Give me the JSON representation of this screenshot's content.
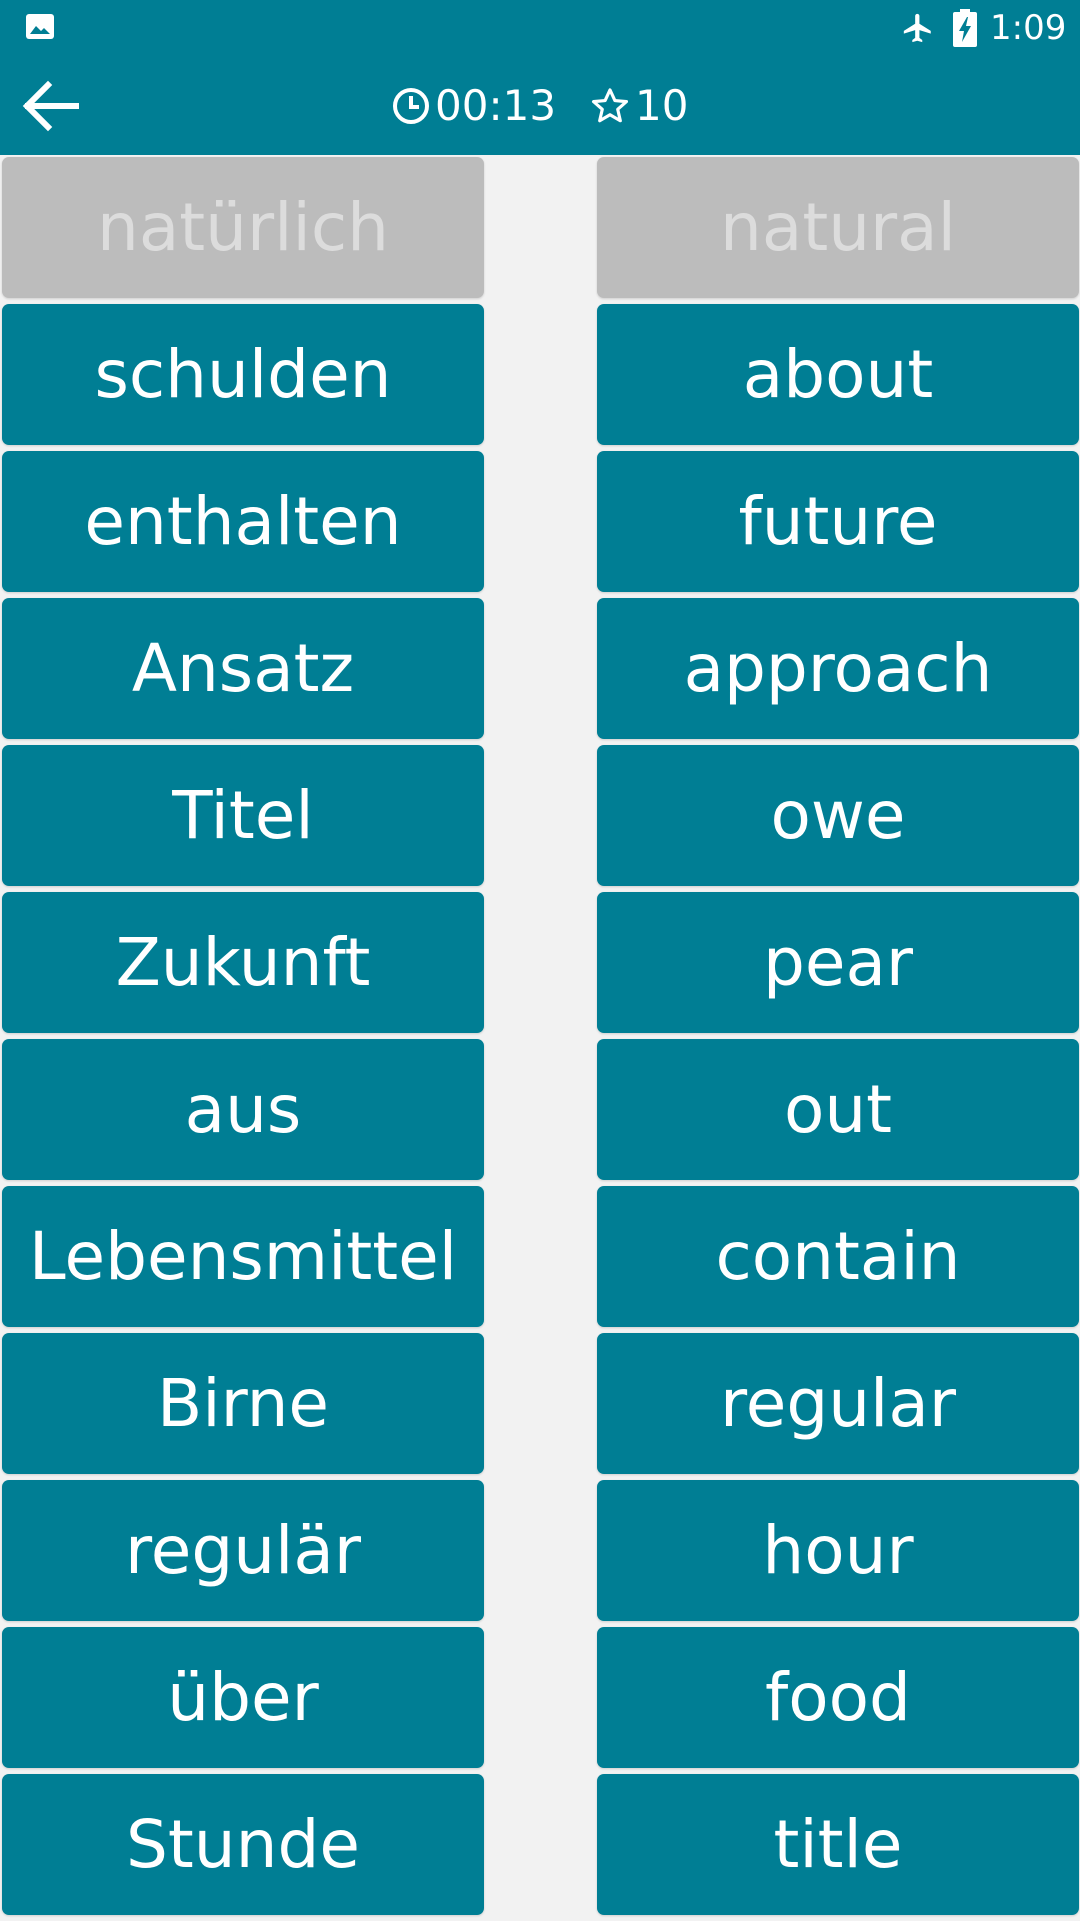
{
  "status_bar": {
    "time": "1:09",
    "icons": [
      "image-icon",
      "airplane-mode-icon",
      "battery-charging-icon"
    ]
  },
  "app_bar": {
    "back_icon": "arrow-left-icon",
    "timer_icon": "clock-icon",
    "timer": "00:13",
    "score_icon": "star-outline-icon",
    "score": "10"
  },
  "colors": {
    "primary": "#007e94",
    "background": "#f2f2f2",
    "matched_tile": "#bcbcbc",
    "matched_text": "#dcdcdc",
    "text": "#ffffff"
  },
  "left_words": [
    {
      "text": "natürlich",
      "matched": true
    },
    {
      "text": "schulden",
      "matched": false
    },
    {
      "text": "enthalten",
      "matched": false
    },
    {
      "text": "Ansatz",
      "matched": false
    },
    {
      "text": "Titel",
      "matched": false
    },
    {
      "text": "Zukunft",
      "matched": false
    },
    {
      "text": "aus",
      "matched": false
    },
    {
      "text": "Lebensmittel",
      "matched": false
    },
    {
      "text": "Birne",
      "matched": false
    },
    {
      "text": "regulär",
      "matched": false
    },
    {
      "text": "über",
      "matched": false
    },
    {
      "text": "Stunde",
      "matched": false
    }
  ],
  "right_words": [
    {
      "text": "natural",
      "matched": true
    },
    {
      "text": "about",
      "matched": false
    },
    {
      "text": "future",
      "matched": false
    },
    {
      "text": "approach",
      "matched": false
    },
    {
      "text": "owe",
      "matched": false
    },
    {
      "text": "pear",
      "matched": false
    },
    {
      "text": "out",
      "matched": false
    },
    {
      "text": "contain",
      "matched": false
    },
    {
      "text": "regular",
      "matched": false
    },
    {
      "text": "hour",
      "matched": false
    },
    {
      "text": "food",
      "matched": false
    },
    {
      "text": "title",
      "matched": false
    }
  ]
}
